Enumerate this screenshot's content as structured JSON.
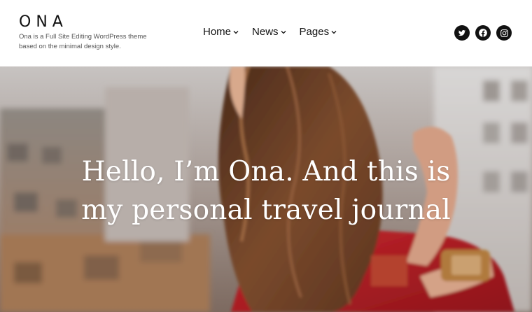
{
  "site": {
    "title": "ONA",
    "tagline": "Ona is a Full Site Editing WordPress theme based on the minimal design style."
  },
  "nav": {
    "items": [
      {
        "label": "Home"
      },
      {
        "label": "News"
      },
      {
        "label": "Pages"
      }
    ]
  },
  "social": {
    "icons": [
      "twitter-icon",
      "facebook-icon",
      "instagram-icon"
    ]
  },
  "hero": {
    "line1": "Hello, I’m Ona. And this is",
    "line2": "my personal travel journal"
  },
  "colors": {
    "text": "#111111",
    "hero_text": "#ffffff",
    "sweater_red": "#b21d24",
    "hair_brown": "#6b3f26"
  }
}
